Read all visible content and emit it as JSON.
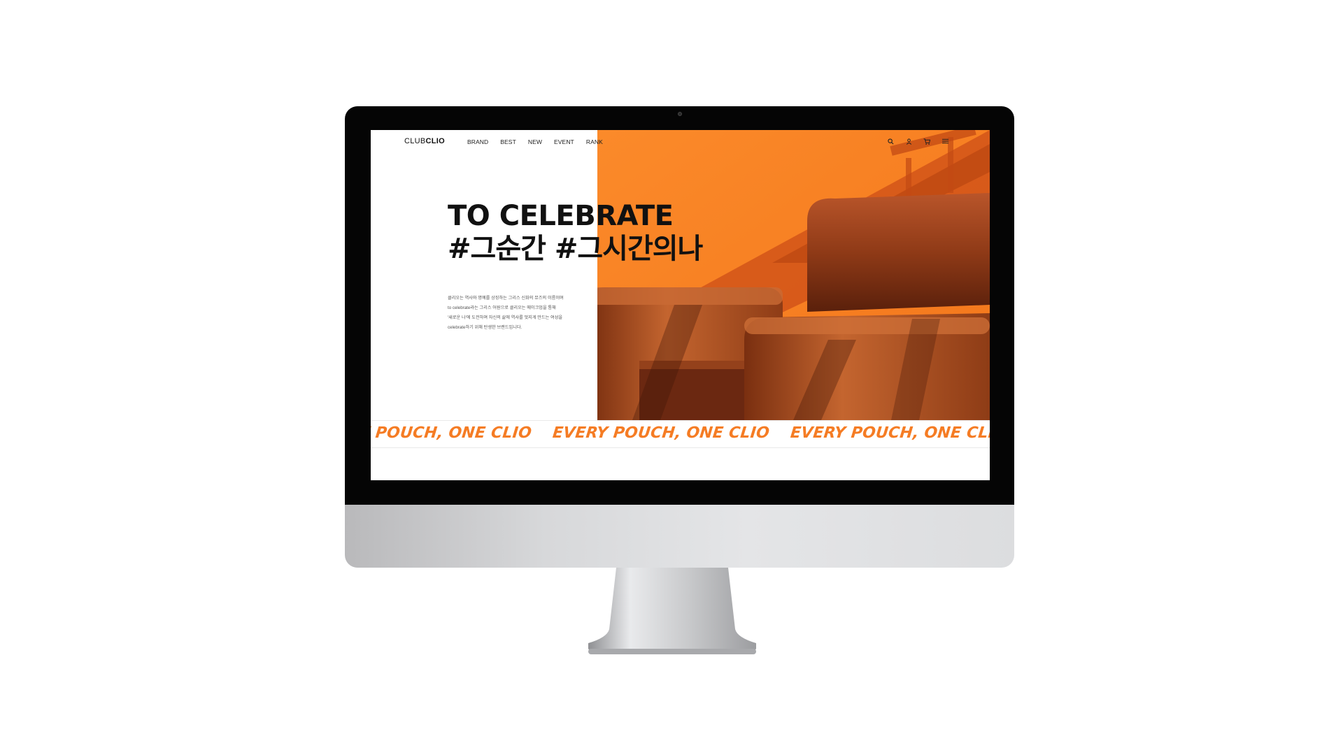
{
  "brand": {
    "logo_bold": "CLUB",
    "logo_light": "CLIO"
  },
  "nav": {
    "items": [
      "BRAND",
      "BEST",
      "NEW",
      "EVENT",
      "RANK"
    ]
  },
  "icons": [
    "search-icon",
    "user-icon",
    "cart-icon",
    "menu-icon"
  ],
  "hero": {
    "headline_line1": "TO CELEBRATE",
    "headline_line2": "#그순간 #그시간의나",
    "description": [
      "클리오는 역사와 명예를 상징하는 그리스 신화의 뮤즈의 이름이며",
      "to celebrate라는 그리스 어원으로 클리오는 메이크업을 통해",
      "'새로운 나'에 도전하며 자신의 삶에 역사를 멋지게 만드는 여성을",
      "celebrate하기 위해 탄생한 브랜드입니다."
    ]
  },
  "ticker": {
    "text": "EVERY POUCH, ONE CLIO"
  },
  "colors": {
    "accent": "#f57c24",
    "text": "#111111",
    "bezel": "#050505"
  }
}
